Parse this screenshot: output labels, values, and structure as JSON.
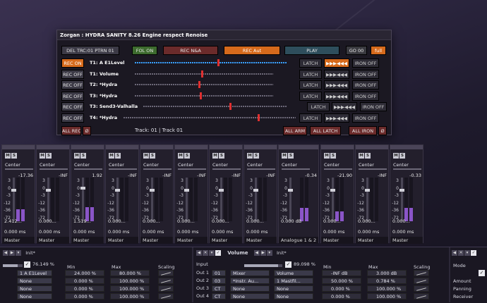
{
  "dialog": {
    "title": "Zorgan : HYDRA SANITY 8.26 Engine respect Renoise",
    "top_buttons": {
      "del": "DEL TRC:01 PTRN 01",
      "fol": "FOL ON",
      "rec_na": "REC N&A",
      "rec_aut": "REC Aut",
      "play": "PLAY",
      "go": "GO 00",
      "full": "full"
    },
    "tracks": [
      {
        "rec": "REC ON",
        "name": "T1: A E1Level",
        "latch": "LATCH",
        "seq": "▶▶▶◀◀◀",
        "iron": "IRON OFF",
        "value": 0.54,
        "active": true
      },
      {
        "rec": "REC OFF",
        "name": "T1: Volume",
        "latch": "LATCH",
        "seq": "▶▶▶◀◀◀",
        "iron": "IRON OFF",
        "value": 0.48,
        "active": false
      },
      {
        "rec": "REC OFF",
        "name": "T2: *Hydra",
        "latch": "LATCH",
        "seq": "▶▶▶◀◀◀",
        "iron": "IRON OFF",
        "value": 0.46,
        "active": false
      },
      {
        "rec": "REC OFF",
        "name": "T3: *Hydra",
        "latch": "LATCH",
        "seq": "▶▶▶◀◀◀",
        "iron": "IRON OFF",
        "value": 0.47,
        "active": false
      },
      {
        "rec": "REC OFF",
        "name": "T3: Send3-Valhalla",
        "latch": "LATCH",
        "seq": "▶▶▶◀◀◀",
        "iron": "IRON OFF",
        "value": 0.6,
        "active": false
      },
      {
        "rec": "REC OFF",
        "name": "T4: *Hydra",
        "latch": "LATCH",
        "seq": "▶▶▶◀◀◀",
        "iron": "IRON OFF",
        "value": 0.78,
        "active": false
      }
    ],
    "footer": {
      "all_rec": "ALL REC",
      "zero": "Ø",
      "info": "Track: 01 | Track 01",
      "all_arm": "ALL ARM",
      "all_latch": "ALL LATCH",
      "all_iron": "ALL IRON",
      "zero2": "Ø"
    }
  },
  "mixer": {
    "mute": "M",
    "solo": "S",
    "scale": [
      "3",
      "0",
      "-3",
      "-12",
      "-36",
      "-72"
    ],
    "strips": [
      {
        "pan": "Center",
        "peak": "-17.36",
        "value": "2.412...",
        "delay": "0.000 ms",
        "out": "Master",
        "fader": 0.72,
        "meter": 0.28
      },
      {
        "pan": "Center",
        "peak": "-INF",
        "value": "0.000...",
        "delay": "0.000 ms",
        "out": "Master",
        "fader": 0.72,
        "meter": 0.0
      },
      {
        "pan": "Center",
        "peak": "1.92",
        "value": "1.519...",
        "delay": "0.000 ms",
        "out": "Master",
        "fader": 0.78,
        "meter": 0.33
      },
      {
        "pan": "Center",
        "peak": "-INF",
        "value": "0.000...",
        "delay": "0.000 ms",
        "out": "Master",
        "fader": 0.72,
        "meter": 0.0
      },
      {
        "pan": "Center",
        "peak": "-INF",
        "value": "0.000...",
        "delay": "0.000 ms",
        "out": "Master",
        "fader": 0.72,
        "meter": 0.0
      },
      {
        "pan": "Center",
        "peak": "-INF",
        "value": "0.000...",
        "delay": "0.000 ms",
        "out": "Master",
        "fader": 0.72,
        "meter": 0.0
      },
      {
        "pan": "Center",
        "peak": "-INF",
        "value": "0.000...",
        "delay": "0.000 ms",
        "out": "Master",
        "fader": 0.72,
        "meter": 0.0
      },
      {
        "pan": "Center",
        "peak": "-INF",
        "value": "0.000...",
        "delay": "0.000 ms",
        "out": "Master",
        "fader": 0.72,
        "meter": 0.0
      }
    ],
    "wide_strip": {
      "pan": "Center",
      "peak": "-0.34",
      "value": "0.000 dB",
      "out": "Analogue 1 & 2",
      "fader": 0.72,
      "meter": 0.3
    },
    "right_strips": [
      {
        "pan": "Center",
        "peak": "-21.90",
        "value": "0.000...",
        "delay": "0.000 ms",
        "out": "Master",
        "fader": 0.72,
        "meter": 0.22
      },
      {
        "pan": "Center",
        "peak": "-INF",
        "value": "0.000...",
        "delay": "0.000 ms",
        "out": "Master",
        "fader": 0.72,
        "meter": 0.0
      },
      {
        "pan": "Center",
        "peak": "-0.33",
        "value": "0.000...",
        "delay": "0.000 ms",
        "out": "Master",
        "fader": 0.72,
        "meter": 0.3
      }
    ]
  },
  "bottom": {
    "left": {
      "preset": "Init*",
      "percent": "76.149 %",
      "percent_fill": 0.76,
      "min_label": "Min",
      "max_label": "Max",
      "scaling_label": "Scaling",
      "rows": [
        {
          "src": "1 A E1Level",
          "min": "24.000 %",
          "max": "80.000 %"
        },
        {
          "src": "None",
          "min": "0.000 %",
          "max": "100.000 %"
        },
        {
          "src": "None",
          "min": "0.000 %",
          "max": "100.000 %"
        },
        {
          "src": "None",
          "min": "0.000 %",
          "max": "100.000 %"
        }
      ]
    },
    "mid": {
      "device": "Volume",
      "preset": "Init*",
      "percent": "89.098 %",
      "percent_fill": 0.89,
      "input_label": "Input",
      "min_label": "Min",
      "max_label": "Max",
      "scaling_label": "Scaling",
      "rows": [
        {
          "out": "Out 1",
          "idx": "01",
          "dev": "Mixer",
          "param": "Volume",
          "min": "-INF dB",
          "max": "3.000 dB"
        },
        {
          "out": "Out 2",
          "idx": "03",
          "dev": "*Instr. Au...",
          "param": "1 Mastfil...",
          "min": "50.000 %",
          "max": "0.784 %"
        },
        {
          "out": "Out 3",
          "idx": "CT",
          "dev": "None",
          "param": "None",
          "min": "0.000 %",
          "max": "100.000 %"
        },
        {
          "out": "Out 4",
          "idx": "CT",
          "dev": "None",
          "param": "None",
          "min": "0.000 %",
          "max": "100.000 %"
        }
      ]
    },
    "right": {
      "mode": "Mode",
      "amount": "Amount",
      "panning": "Panning",
      "receiver": "Receiver"
    }
  }
}
